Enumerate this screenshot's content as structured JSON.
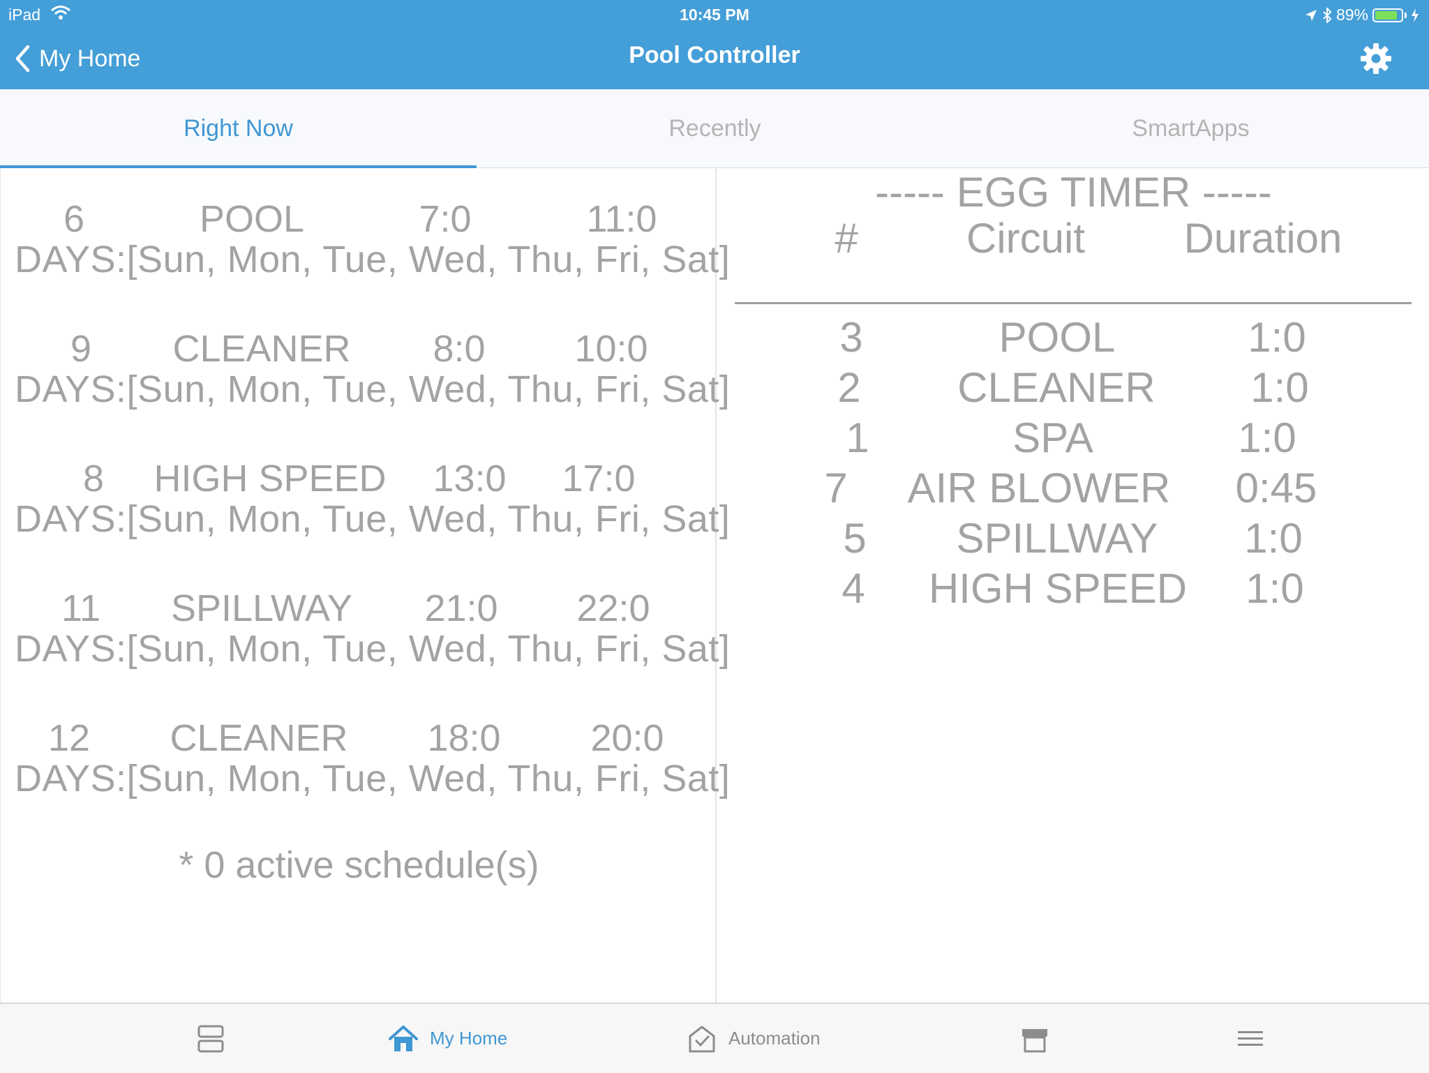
{
  "status_bar": {
    "device": "iPad",
    "time": "10:45 PM",
    "battery_percent": "89%",
    "battery_level": 0.89
  },
  "nav": {
    "back_label": "My Home",
    "title": "Pool Controller",
    "settings_icon": "gear-icon"
  },
  "tabs": [
    {
      "label": "Right Now",
      "active": true
    },
    {
      "label": "Recently",
      "active": false
    },
    {
      "label": "SmartApps",
      "active": false
    }
  ],
  "schedules": [
    {
      "id": "6",
      "circuit": "POOL",
      "start": "7:0",
      "end": "11:0",
      "days": "DAYS:[Sun, Mon, Tue, Wed, Thu, Fri, Sat]"
    },
    {
      "id": "9",
      "circuit": "CLEANER",
      "start": "8:0",
      "end": "10:0",
      "days": "DAYS:[Sun, Mon, Tue, Wed, Thu, Fri, Sat]"
    },
    {
      "id": "8",
      "circuit": "HIGH SPEED",
      "start": "13:0",
      "end": "17:0",
      "days": "DAYS:[Sun, Mon, Tue, Wed, Thu, Fri, Sat]"
    },
    {
      "id": "11",
      "circuit": "SPILLWAY",
      "start": "21:0",
      "end": "22:0",
      "days": "DAYS:[Sun, Mon, Tue, Wed, Thu, Fri, Sat]"
    },
    {
      "id": "12",
      "circuit": "CLEANER",
      "start": "18:0",
      "end": "20:0",
      "days": "DAYS:[Sun, Mon, Tue, Wed, Thu, Fri, Sat]"
    }
  ],
  "active_note": "* 0 active schedule(s)",
  "egg_timer": {
    "title": "----- EGG TIMER -----",
    "headers": {
      "num": "#",
      "circuit": "Circuit",
      "duration": "Duration"
    },
    "rows": [
      {
        "num": "3",
        "circuit": "POOL",
        "duration": "1:0"
      },
      {
        "num": "2",
        "circuit": "CLEANER",
        "duration": "1:0"
      },
      {
        "num": "1",
        "circuit": "SPA",
        "duration": "1:0"
      },
      {
        "num": "7",
        "circuit": "AIR BLOWER",
        "duration": "0:45"
      },
      {
        "num": "5",
        "circuit": "SPILLWAY",
        "duration": "1:0"
      },
      {
        "num": "4",
        "circuit": "HIGH SPEED",
        "duration": "1:0"
      }
    ]
  },
  "bottom_bar": [
    {
      "label": "",
      "icon": "dashboard-icon"
    },
    {
      "label": "My Home",
      "icon": "home-icon",
      "active": true
    },
    {
      "label": "Automation",
      "icon": "automation-icon"
    },
    {
      "label": "",
      "icon": "marketplace-icon"
    },
    {
      "label": "",
      "icon": "menu-icon"
    }
  ],
  "colors": {
    "accent": "#449ed8",
    "tab_active": "#3f97d3",
    "text_grey": "#a3a3a3"
  }
}
